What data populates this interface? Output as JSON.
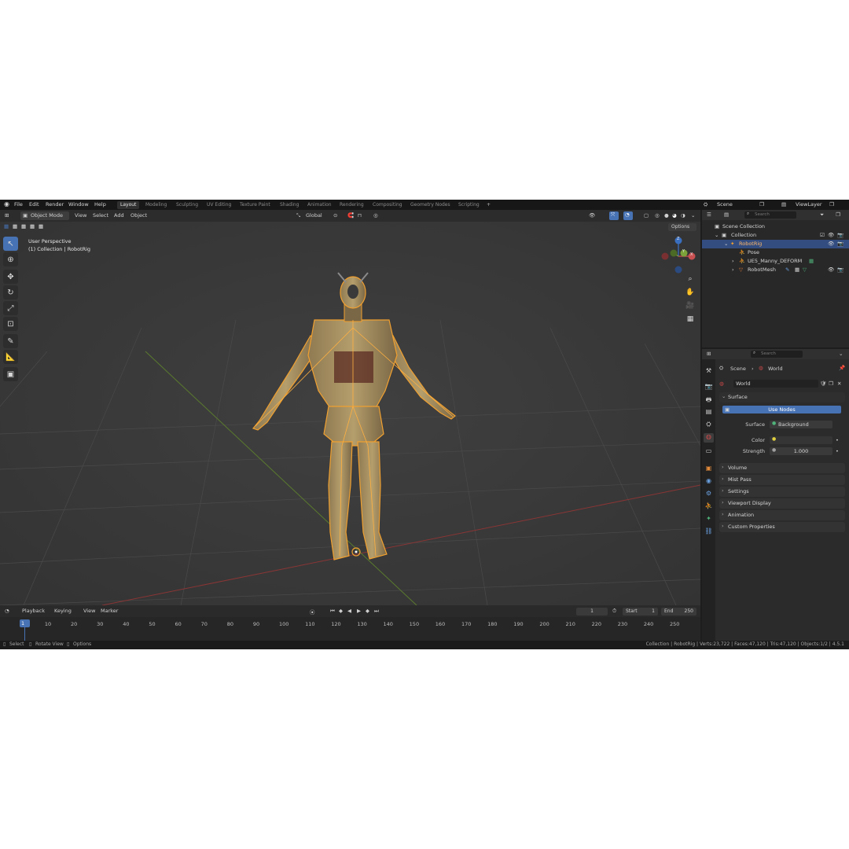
{
  "menu": [
    "File",
    "Edit",
    "Render",
    "Window",
    "Help"
  ],
  "workspace_tabs": [
    {
      "label": "Layout",
      "active": true
    },
    {
      "label": "Modeling",
      "active": false
    },
    {
      "label": "Sculpting",
      "active": false
    },
    {
      "label": "UV Editing",
      "active": false
    },
    {
      "label": "Texture Paint",
      "active": false
    },
    {
      "label": "Shading",
      "active": false
    },
    {
      "label": "Animation",
      "active": false
    },
    {
      "label": "Rendering",
      "active": false
    },
    {
      "label": "Compositing",
      "active": false
    },
    {
      "label": "Geometry Nodes",
      "active": false
    },
    {
      "label": "Scripting",
      "active": false
    }
  ],
  "add_workspace_glyph": "+",
  "scene_selector": {
    "scene": "Scene",
    "view_layer": "ViewLayer"
  },
  "viewport": {
    "mode": "Object Mode",
    "menus": [
      "View",
      "Select",
      "Add",
      "Object"
    ],
    "transform_orientation": "Global",
    "options_label": "Options",
    "overlay_line1": "User Perspective",
    "overlay_line2": "(1) Collection | RobotRig",
    "gizmo_labels": {
      "z": "Z",
      "y": "Y",
      "x": "X"
    }
  },
  "outliner": {
    "search_placeholder": "Search",
    "rows": [
      {
        "label": "Scene Collection",
        "icon": "scene-collection-icon"
      },
      {
        "label": "Collection",
        "icon": "collection-icon"
      },
      {
        "label": "RobotRig",
        "icon": "armature-icon",
        "selected": true
      },
      {
        "label": "Pose",
        "icon": "pose-icon"
      },
      {
        "label": "UE5_Manny_DEFORM",
        "icon": "armature-data-icon"
      },
      {
        "label": "RobotMesh",
        "icon": "mesh-icon"
      }
    ]
  },
  "properties": {
    "search_placeholder": "Search",
    "breadcrumb": {
      "scene": "Scene",
      "world": "World"
    },
    "world_name": "World",
    "surface_panel": "Surface",
    "use_nodes_label": "Use Nodes",
    "surface_label": "Surface",
    "surface_value": "Background",
    "color_label": "Color",
    "strength_label": "Strength",
    "strength_value": "1.000",
    "collapsed_panels": [
      "Volume",
      "Mist Pass",
      "Settings",
      "Viewport Display",
      "Animation",
      "Custom Properties"
    ]
  },
  "timeline": {
    "menus": [
      "Playback",
      "Keying",
      "View",
      "Marker"
    ],
    "current_frame": "1",
    "start_label": "Start",
    "start_value": "1",
    "end_label": "End",
    "end_value": "250",
    "frame_numbers": [
      "1",
      "10",
      "20",
      "30",
      "40",
      "50",
      "60",
      "70",
      "80",
      "90",
      "100",
      "110",
      "120",
      "130",
      "140",
      "150",
      "160",
      "170",
      "180",
      "190",
      "200",
      "210",
      "220",
      "230",
      "240",
      "250"
    ]
  },
  "statusbar": {
    "left": [
      "Select",
      "Rotate View",
      "Options"
    ],
    "right": "Collection | RobotRig | Verts:23,722 | Faces:47,120 | Tris:47,120 | Objects:1/2 | 4.5.1"
  },
  "colors": {
    "accent": "#4772b3",
    "selection_orange": "#f0a030",
    "axis_x": "#c84545",
    "axis_y": "#7ca33a"
  }
}
